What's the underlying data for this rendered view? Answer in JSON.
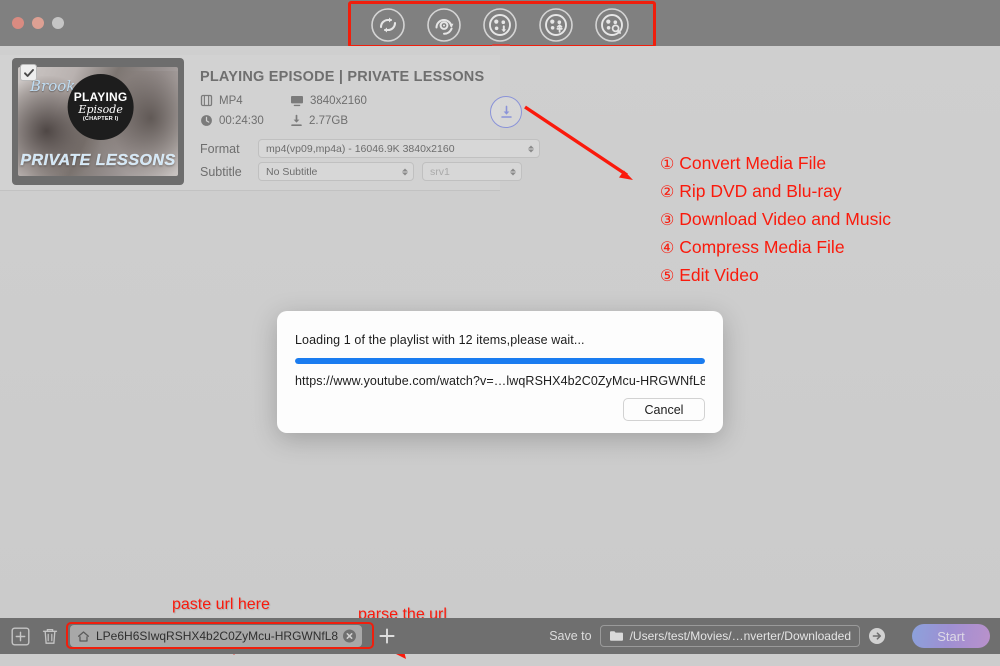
{
  "window": {
    "traffic_lights": [
      "close",
      "minimize",
      "maximize"
    ]
  },
  "toolbar": {
    "items": [
      {
        "id": "convert",
        "icon": "convert-arrows-icon",
        "label": "Convert"
      },
      {
        "id": "ripper",
        "icon": "disc-rip-icon",
        "label": "Ripper"
      },
      {
        "id": "download",
        "icon": "reel-download-icon",
        "label": "Downloader"
      },
      {
        "id": "compress",
        "icon": "reel-compress-icon",
        "label": "Compress"
      },
      {
        "id": "edit",
        "icon": "reel-edit-icon",
        "label": "Editor"
      }
    ],
    "active_index": 2,
    "highlight_color": "#f01e0c"
  },
  "media_card": {
    "checkbox_checked": true,
    "thumbnail": {
      "script_text": "Brooke",
      "badge_line1": "PLAYING",
      "badge_line2": "Episode",
      "badge_line3": "(CHAPTER I)",
      "bottom_title": "PRIVATE LESSONS"
    },
    "title": "PLAYING EPISODE | PRIVATE LESSONS",
    "meta": [
      {
        "icon": "file-video-icon",
        "value": "MP4"
      },
      {
        "icon": "monitor-icon",
        "value": "3840x2160"
      },
      {
        "icon": "clock-icon",
        "value": "00:24:30"
      },
      {
        "icon": "download-size-icon",
        "value": "2.77GB"
      }
    ],
    "download_button": {
      "icon": "download-circle-icon"
    },
    "format": {
      "label": "Format",
      "value": "mp4(vp09,mp4a) - 16046.9K 3840x2160"
    },
    "subtitle": {
      "label": "Subtitle",
      "value": "No Subtitle",
      "track_value": "srv1"
    }
  },
  "annotations": {
    "feature_list": [
      {
        "num": "①",
        "text": "Convert Media File"
      },
      {
        "num": "②",
        "text": "Rip DVD and Blu-ray"
      },
      {
        "num": "③",
        "text": "Download Video and Music"
      },
      {
        "num": "④",
        "text": "Compress Media File"
      },
      {
        "num": "⑤",
        "text": "Edit Video"
      }
    ],
    "paste_url": "paste url here",
    "parse_url": "parse the url",
    "color": "#fa1a0c"
  },
  "modal": {
    "message": "Loading 1 of the playlist with 12 items,please wait...",
    "progress_percent": 100,
    "progress_color": "#1a7cf0",
    "url": "https://www.youtube.com/watch?v=…lwqRSHX4b2C0ZyMcu-HRGWNfL8",
    "cancel_label": "Cancel"
  },
  "bottombar": {
    "add_icon": "add-file-icon",
    "delete_icon": "trash-icon",
    "url_input": {
      "icon": "home-icon",
      "value": "LPe6H6SIwqRSHX4b2C0ZyMcu-HRGWNfL8",
      "clear_icon": "clear-circle-icon"
    },
    "parse_icon": "plus-icon",
    "save_to_label": "Save to",
    "save_path": "/Users/test/Movies/…nverter/Downloaded",
    "folder_icon": "folder-icon",
    "go_icon": "arrow-right-circle-icon",
    "start_label": "Start"
  }
}
